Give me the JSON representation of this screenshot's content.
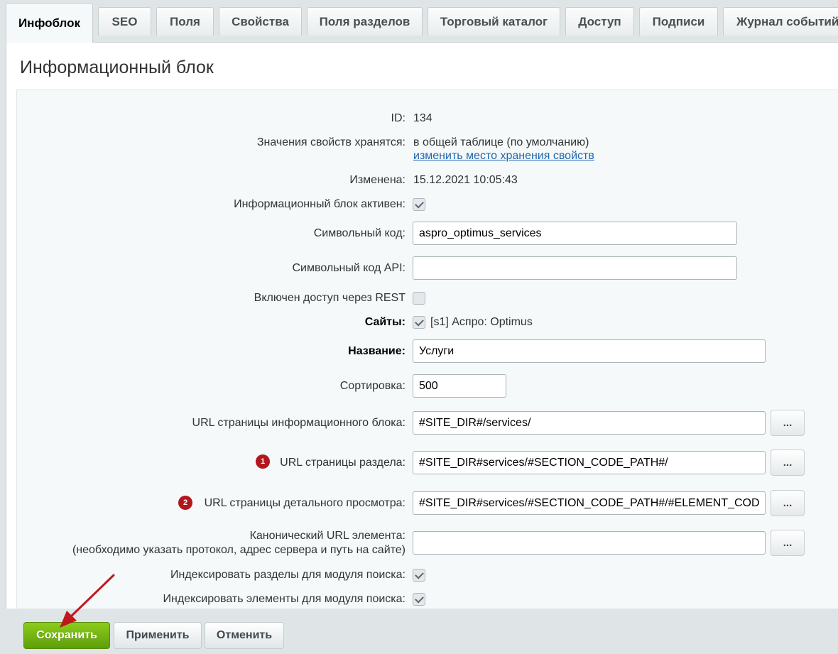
{
  "tabs": [
    "Инфоблок",
    "SEO",
    "Поля",
    "Свойства",
    "Поля разделов",
    "Торговый каталог",
    "Доступ",
    "Подписи",
    "Журнал событий"
  ],
  "title": "Информационный блок",
  "fields": {
    "id": {
      "label": "ID:",
      "value": "134"
    },
    "storage": {
      "label": "Значения свойств хранятся:",
      "value": "в общей таблице (по умолчанию)",
      "link": "изменить место хранения свойств"
    },
    "modified": {
      "label": "Изменена:",
      "value": "15.12.2021 10:05:43"
    },
    "active": {
      "label": "Информационный блок активен:",
      "checked": true
    },
    "code": {
      "label": "Символьный код:",
      "value": "aspro_optimus_services"
    },
    "api_code": {
      "label": "Символьный код API:",
      "value": ""
    },
    "rest": {
      "label": "Включен доступ через REST",
      "checked": false
    },
    "sites": {
      "label": "Сайты:",
      "value": "[s1] Аспро: Optimus",
      "checked": true
    },
    "name": {
      "label": "Название:",
      "value": "Услуги"
    },
    "sort": {
      "label": "Сортировка:",
      "value": "500"
    },
    "list_url": {
      "label": "URL страницы информационного блока:",
      "value": "#SITE_DIR#/services/"
    },
    "section_url": {
      "label": "URL страницы раздела:",
      "value": "#SITE_DIR#services/#SECTION_CODE_PATH#/",
      "badge": "1"
    },
    "detail_url": {
      "label": "URL страницы детального просмотра:",
      "value": "#SITE_DIR#services/#SECTION_CODE_PATH#/#ELEMENT_CODE#/",
      "badge": "2"
    },
    "canonical": {
      "label_line1": "Канонический URL элемента:",
      "label_line2": "(необходимо указать протокол, адрес сервера и путь на сайте)",
      "value": ""
    },
    "index_sections": {
      "label": "Индексировать разделы для модуля поиска:",
      "checked": true
    },
    "index_elements": {
      "label": "Индексировать элементы для модуля поиска:",
      "checked": true
    }
  },
  "dots_label": "...",
  "buttons": {
    "save": "Сохранить",
    "apply": "Применить",
    "cancel": "Отменить"
  },
  "colors": {
    "save_button": "#6aab12",
    "badge": "#b3171e",
    "arrow": "#c0171e",
    "link": "#2067b0"
  }
}
